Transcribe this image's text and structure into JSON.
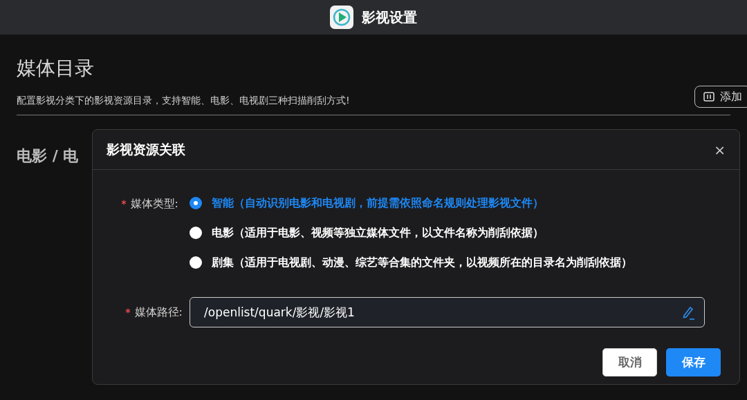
{
  "top_bar": {
    "title": "影视设置"
  },
  "page": {
    "title": "媒体目录",
    "description": "配置影视分类下的影视资源目录，支持智能、电影、电视剧三种扫描削刮方式!",
    "add_button": "添加",
    "section_title": "电影 / 电"
  },
  "dialog": {
    "title": "影视资源关联",
    "close": "×",
    "type_field": {
      "label": "媒体类型:",
      "required": true,
      "options": [
        {
          "label": "智能（自动识别电影和电视剧，前提需依照命名规则处理影视文件）",
          "selected": true
        },
        {
          "label": "电影（适用于电影、视频等独立媒体文件，以文件名称为削刮依据）",
          "selected": false
        },
        {
          "label": "剧集（适用于电视剧、动漫、综艺等合集的文件夹，以视频所在的目录名为削刮依据）",
          "selected": false
        }
      ]
    },
    "path_field": {
      "label": "媒体路径:",
      "required": true,
      "value": "/openlist/quark/影视/影视1"
    },
    "buttons": [
      {
        "label": "取消",
        "kind": "secondary"
      },
      {
        "label": "保存",
        "kind": "primary"
      }
    ]
  }
}
